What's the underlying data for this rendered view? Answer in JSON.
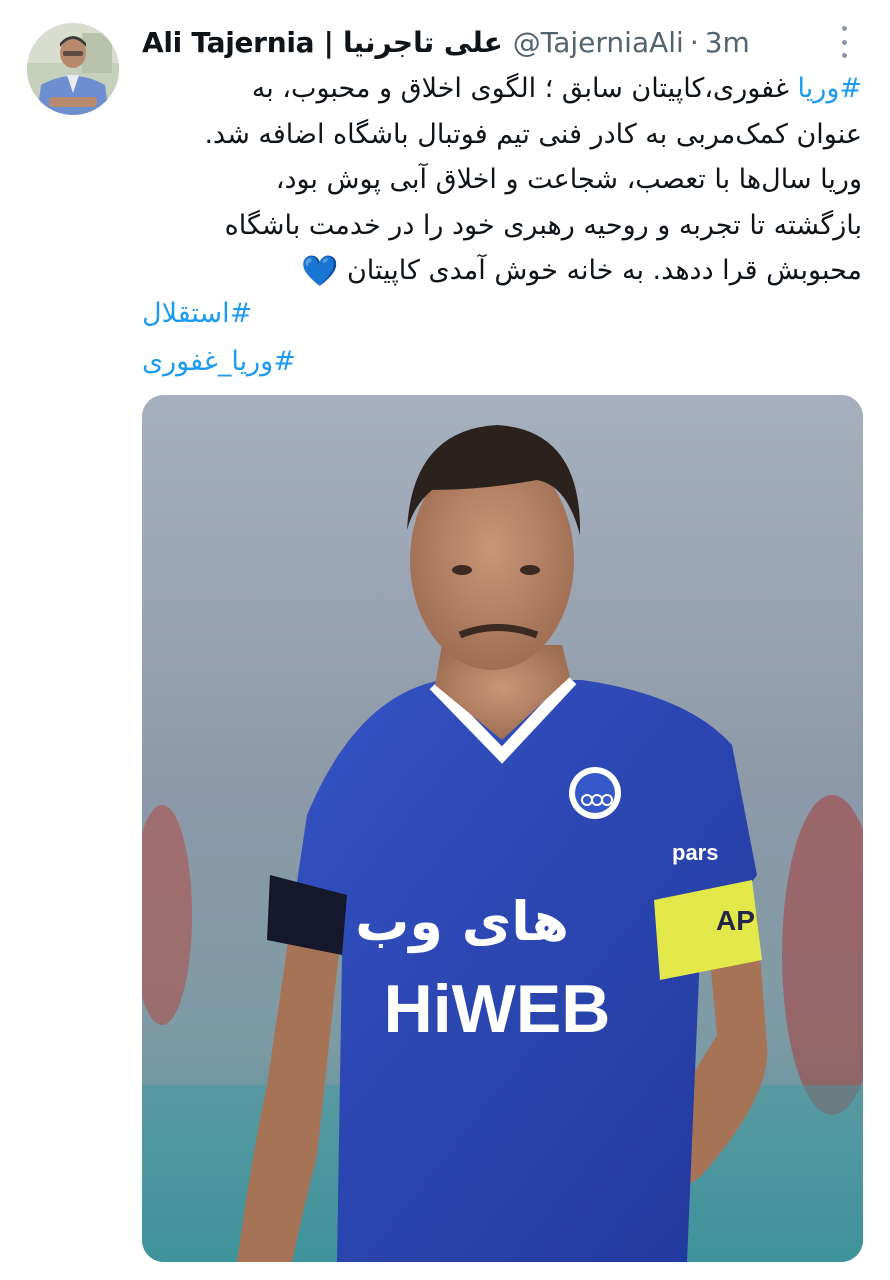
{
  "tweet": {
    "author": {
      "display_name": "Ali Tajernia | علی تاجرنیا",
      "handle": "@TajerniaAli",
      "separator": "·",
      "time": "3m"
    },
    "text": {
      "line1_hashtag": "#وریا",
      "line1_rest": " غفوری،کاپیتان سابق ؛ الگوی اخلاق و محبوب، به",
      "line2": "عنوان کمک‌مربی به کادر فنی تیم فوتبال باشگاه اضافه شد.",
      "line3": "وریا سال‌ها با تعصب، شجاعت و اخلاق آبی پوش بود،",
      "line4": "بازگشته تا تجربه و روحیه رهبری خود را در خدمت  باشگاه",
      "line5": "محبوبش قرا ددهد. به خانه خوش آمدی کاپیتان",
      "emoji": "💙"
    },
    "hashtags": [
      "#استقلال",
      "#وریا_غفوری"
    ],
    "media": {
      "jersey_sponsor_fa": "های وب",
      "jersey_sponsor_en": "HiWEB",
      "sleeve_text": "pars",
      "armband_text": "AP"
    },
    "colors": {
      "link": "#1d9bf0",
      "secondary_text": "#536471",
      "jersey_blue": "#2a47b8",
      "armband_yellow": "#e3e84a"
    },
    "icons": {
      "more": "more-vertical-icon",
      "heart": "blue-heart-icon"
    }
  }
}
